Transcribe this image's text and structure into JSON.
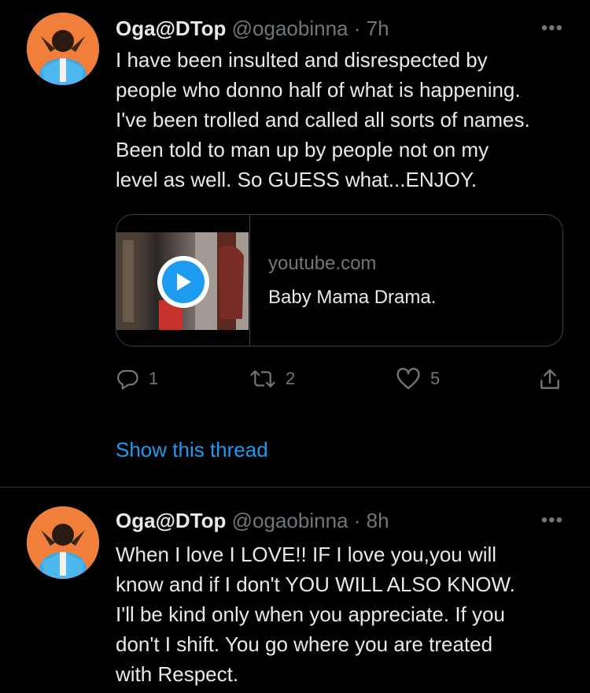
{
  "tweets": [
    {
      "name": "Oga@DTop",
      "handle": "@ogaobinna",
      "separator": "·",
      "time": "7h",
      "more": "•••",
      "text": "I have been insulted and disrespected by\npeople who donno half of what is happening.\nI've been trolled and called all sorts of names.\nBeen told to man up by people not on my\nlevel as well. So GUESS what...ENJOY.",
      "card": {
        "domain": "youtube.com",
        "title": "Baby Mama Drama."
      },
      "actions": {
        "replies": "1",
        "retweets": "2",
        "likes": "5"
      },
      "thread_link": "Show this thread"
    },
    {
      "name": "Oga@DTop",
      "handle": "@ogaobinna",
      "separator": "·",
      "time": "8h",
      "more": "•••",
      "text": "When I love I LOVE!! IF I love you,you will\nknow and if I don't YOU WILL ALSO KNOW.\nI'll be kind only when you appreciate. If you\ndon't I shift. You go where you are treated\nwith Respect."
    }
  ],
  "colors": {
    "background": "#000000",
    "text": "#e7e9ea",
    "muted": "#71767b",
    "accent": "#1d9bf0",
    "border": "#2f3336"
  },
  "icons": {
    "reply": "reply-icon",
    "retweet": "retweet-icon",
    "like": "heart-icon",
    "share": "share-icon",
    "play": "play-icon"
  }
}
